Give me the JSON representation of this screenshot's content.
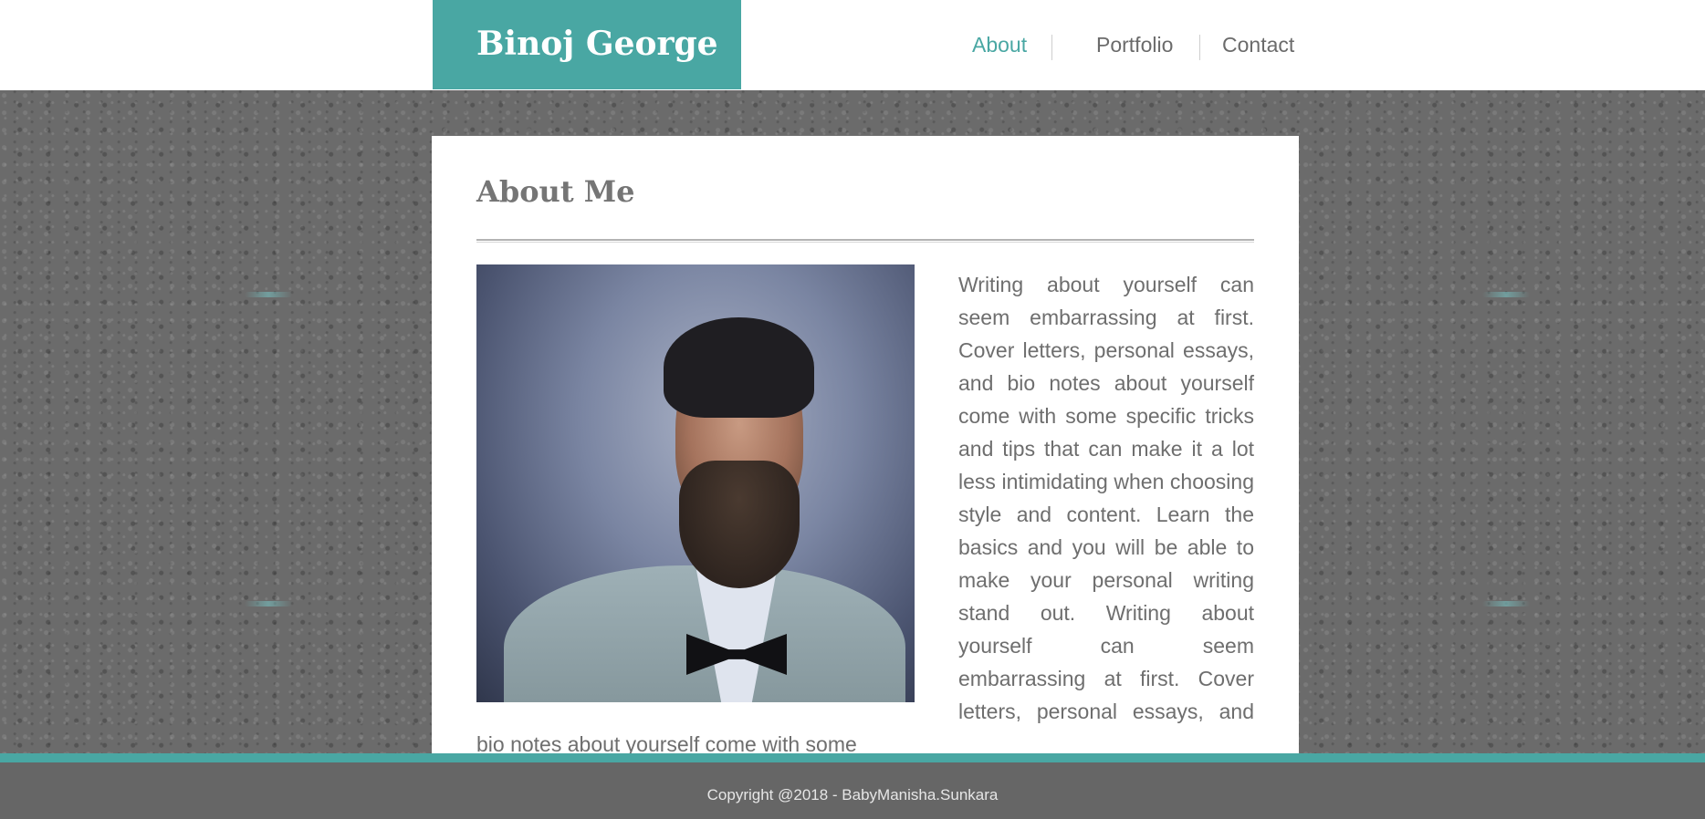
{
  "header": {
    "brand": "Binoj George",
    "nav": [
      {
        "label": "About",
        "active": true
      },
      {
        "label": "Portfolio",
        "active": false
      },
      {
        "label": "Contact",
        "active": false
      }
    ]
  },
  "main": {
    "title": "About Me",
    "photo_alt": "portrait",
    "paragraph": "Writing about yourself can seem embarrassing at first. Cover letters, personal essays, and bio notes about yourself come with some specific tricks and tips that can make it a lot less intimidating when choosing style and content. Learn the basics and you will be able to make your personal writing stand out. Writing about yourself can seem embarrassing at first. Cover letters, personal essays, and bio notes about yourself come with some"
  },
  "footer": {
    "copyright": "Copyright @2018 - BabyManisha.Sunkara"
  },
  "colors": {
    "accent": "#49a7a3",
    "background": "#6b6b6b",
    "footer": "#666666",
    "text": "#6e6e6e"
  }
}
